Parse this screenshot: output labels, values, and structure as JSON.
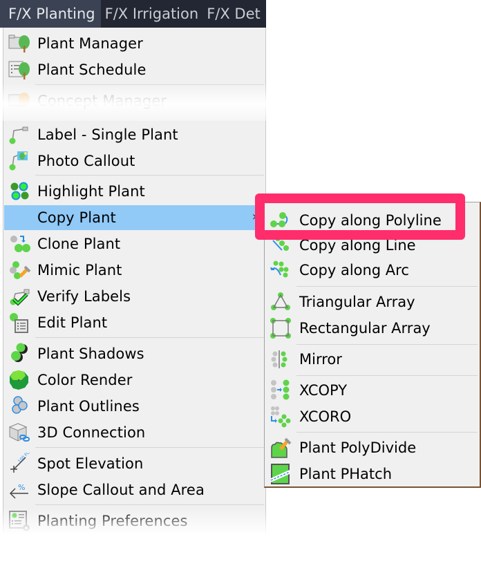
{
  "menubar": {
    "tabs": [
      {
        "label": "F/X Planting",
        "active": true
      },
      {
        "label": "F/X Irrigation",
        "active": false
      },
      {
        "label": "F/X Det",
        "active": false
      }
    ]
  },
  "main_menu": {
    "items": [
      {
        "label": "Plant Manager",
        "icon": "plant-manager-icon"
      },
      {
        "label": "Plant Schedule",
        "icon": "plant-schedule-icon"
      },
      {
        "label": "Concept Manager",
        "icon": "concept-manager-icon",
        "disabled": true
      },
      {
        "label": "Label - Single Plant",
        "icon": "label-single-plant-icon"
      },
      {
        "label": "Photo Callout",
        "icon": "photo-callout-icon"
      },
      {
        "label": "Highlight Plant",
        "icon": "highlight-plant-icon"
      },
      {
        "label": "Copy Plant",
        "icon": "",
        "highlighted": true,
        "submenu_arrow": "›"
      },
      {
        "label": "Clone Plant",
        "icon": "clone-plant-icon"
      },
      {
        "label": "Mimic Plant",
        "icon": "mimic-plant-icon"
      },
      {
        "label": "Verify Labels",
        "icon": "verify-labels-icon"
      },
      {
        "label": "Edit Plant",
        "icon": "edit-plant-icon"
      },
      {
        "label": "Plant Shadows",
        "icon": "plant-shadows-icon"
      },
      {
        "label": "Color Render",
        "icon": "color-render-icon"
      },
      {
        "label": "Plant Outlines",
        "icon": "plant-outlines-icon"
      },
      {
        "label": "3D Connection",
        "icon": "3d-connection-icon"
      },
      {
        "label": "Spot Elevation",
        "icon": "spot-elevation-icon"
      },
      {
        "label": "Slope Callout and Area",
        "icon": "slope-callout-icon"
      },
      {
        "label": "Planting Preferences",
        "icon": "planting-preferences-icon"
      }
    ]
  },
  "sub_menu": {
    "items": [
      {
        "label": "Copy along Polyline",
        "icon": "copy-along-polyline-icon",
        "callout": true
      },
      {
        "label": "Copy along Line",
        "icon": "copy-along-line-icon"
      },
      {
        "label": "Copy along Arc",
        "icon": "copy-along-arc-icon"
      },
      {
        "label": "Triangular Array",
        "icon": "triangular-array-icon"
      },
      {
        "label": "Rectangular Array",
        "icon": "rectangular-array-icon"
      },
      {
        "label": "Mirror",
        "icon": "mirror-icon"
      },
      {
        "label": "XCOPY",
        "icon": "xcopy-icon"
      },
      {
        "label": "XCORO",
        "icon": "xcoro-icon"
      },
      {
        "label": "Plant PolyDivide",
        "icon": "plant-polydivide-icon"
      },
      {
        "label": "Plant PHatch",
        "icon": "plant-phatch-icon"
      }
    ]
  },
  "colors": {
    "menubar_bg": "#222733",
    "active_tab_bg": "#3b4253",
    "menu_bg": "#f0f0f0",
    "highlight": "#91c9f7",
    "callout_border": "#ff2d6b",
    "plant_green": "#5ed44a"
  }
}
